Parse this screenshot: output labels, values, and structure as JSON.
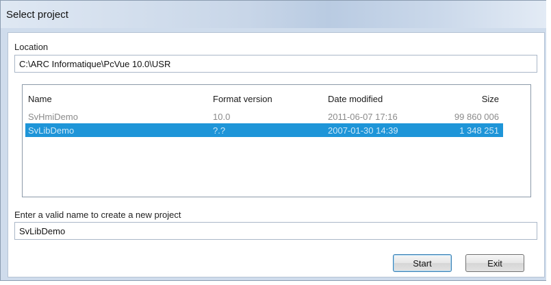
{
  "window": {
    "title": "Select project"
  },
  "location": {
    "label": "Location",
    "value": "C:\\ARC Informatique\\PcVue 10.0\\USR"
  },
  "table": {
    "columns": [
      "Name",
      "Format version",
      "Date modified",
      "Size"
    ],
    "rows": [
      {
        "name": "SvHmiDemo",
        "version": "10.0",
        "date": "2011-06-07  17:16",
        "size": "99 860 006",
        "selected": false
      },
      {
        "name": "SvLibDemo",
        "version": "?.?",
        "date": "2007-01-30  14:39",
        "size": "1 348 251",
        "selected": true
      }
    ]
  },
  "new_project": {
    "label": "Enter a valid name to create a new project",
    "value": "SvLibDemo"
  },
  "buttons": {
    "start": "Start",
    "exit": "Exit"
  },
  "colors": {
    "selection": "#1e95d8"
  }
}
